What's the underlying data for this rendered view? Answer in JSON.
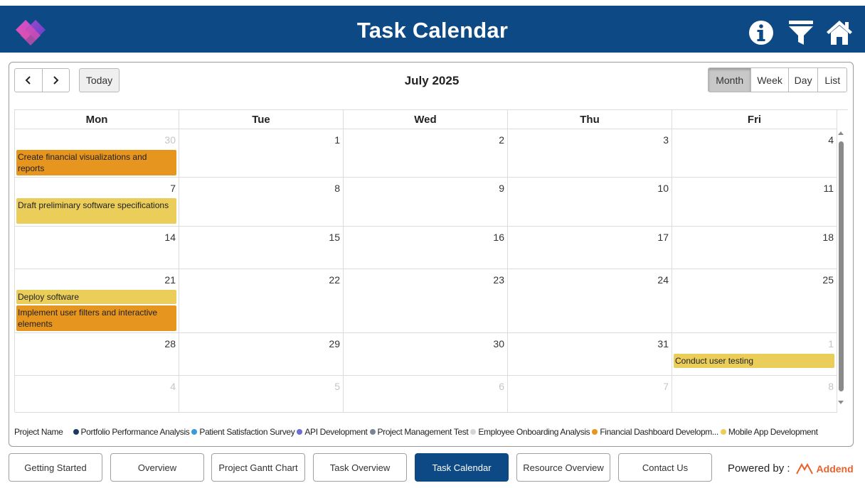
{
  "app": {
    "title": "Task Calendar"
  },
  "header_icons": [
    "info-icon",
    "filter-icon",
    "home-icon"
  ],
  "toolbar": {
    "prev_icon": "‹",
    "next_icon": "›",
    "today_label": "Today",
    "month_title": "July 2025"
  },
  "views": [
    "Month",
    "Week",
    "Day",
    "List"
  ],
  "active_view": "Month",
  "weekdays": [
    "Mon",
    "Tue",
    "Wed",
    "Thu",
    "Fri"
  ],
  "weeks": [
    {
      "days": [
        {
          "num": "30",
          "other": true,
          "events": [
            {
              "title": "Create financial visualizations and reports",
              "project": "Financial Dashboard Developm..."
            }
          ]
        },
        {
          "num": "1",
          "other": false,
          "events": []
        },
        {
          "num": "2",
          "other": false,
          "events": []
        },
        {
          "num": "3",
          "other": false,
          "events": []
        },
        {
          "num": "4",
          "other": false,
          "events": []
        }
      ]
    },
    {
      "days": [
        {
          "num": "7",
          "other": false,
          "events": [
            {
              "title": "Draft preliminary software specifications",
              "project": "Mobile App Development"
            }
          ]
        },
        {
          "num": "8",
          "other": false,
          "events": []
        },
        {
          "num": "9",
          "other": false,
          "events": []
        },
        {
          "num": "10",
          "other": false,
          "events": []
        },
        {
          "num": "11",
          "other": false,
          "events": []
        }
      ]
    },
    {
      "days": [
        {
          "num": "14",
          "other": false,
          "events": []
        },
        {
          "num": "15",
          "other": false,
          "events": []
        },
        {
          "num": "16",
          "other": false,
          "events": []
        },
        {
          "num": "17",
          "other": false,
          "events": []
        },
        {
          "num": "18",
          "other": false,
          "events": []
        }
      ]
    },
    {
      "days": [
        {
          "num": "21",
          "other": false,
          "events": [
            {
              "title": "Deploy software",
              "project": "Mobile App Development"
            },
            {
              "title": "Implement user filters and interactive elements",
              "project": "Financial Dashboard Developm..."
            }
          ]
        },
        {
          "num": "22",
          "other": false,
          "events": []
        },
        {
          "num": "23",
          "other": false,
          "events": []
        },
        {
          "num": "24",
          "other": false,
          "events": []
        },
        {
          "num": "25",
          "other": false,
          "events": []
        }
      ]
    },
    {
      "days": [
        {
          "num": "28",
          "other": false,
          "events": []
        },
        {
          "num": "29",
          "other": false,
          "events": []
        },
        {
          "num": "30",
          "other": false,
          "events": []
        },
        {
          "num": "31",
          "other": false,
          "events": []
        },
        {
          "num": "1",
          "other": true,
          "events": [
            {
              "title": "Conduct user testing",
              "project": "Mobile App Development"
            }
          ]
        }
      ]
    },
    {
      "days": [
        {
          "num": "4",
          "other": true,
          "events": []
        },
        {
          "num": "5",
          "other": true,
          "events": []
        },
        {
          "num": "6",
          "other": true,
          "events": []
        },
        {
          "num": "7",
          "other": true,
          "events": []
        },
        {
          "num": "8",
          "other": true,
          "events": []
        }
      ]
    }
  ],
  "legend": {
    "title": "Project Name",
    "items": [
      {
        "label": "Portfolio Performance Analysis",
        "color": "#1b3a5e"
      },
      {
        "label": "Patient Satisfaction Survey",
        "color": "#3a9ad9"
      },
      {
        "label": "API Development",
        "color": "#6b6fd1"
      },
      {
        "label": "Project Management Test",
        "color": "#7d8594"
      },
      {
        "label": "Employee Onboarding Analysis",
        "color": "#d6d6d6"
      },
      {
        "label": "Financial Dashboard Developm...",
        "color": "#e6951f"
      },
      {
        "label": "Mobile App Development",
        "color": "#ebcd5a"
      }
    ]
  },
  "bottom_nav": [
    "Getting Started",
    "Overview",
    "Project Gantt Chart",
    "Task Overview",
    "Task Calendar",
    "Resource Overview",
    "Contact Us"
  ],
  "bottom_nav_active": "Task Calendar",
  "footer": {
    "powered_label": "Powered by :",
    "brand": "Addend"
  },
  "colors": {
    "header_bg": "#0d4a85",
    "accent_orange": "#e6951f",
    "accent_yellow": "#ebcd5a",
    "brand_orange": "#e8622a"
  }
}
